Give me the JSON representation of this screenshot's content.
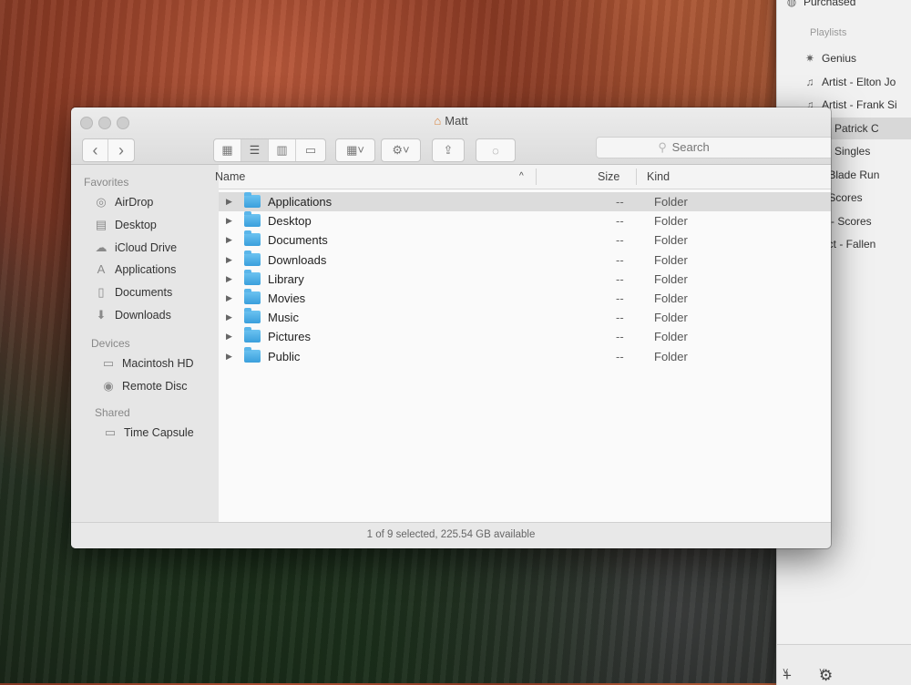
{
  "itunes": {
    "top_item": "Purchased",
    "playlists_header": "Playlists",
    "playlists": [
      {
        "label": "Genius",
        "icon": "genius-icon"
      },
      {
        "label": "Artist - Elton Jo",
        "icon": "playlist-icon"
      },
      {
        "label": "Artist - Frank Si",
        "icon": "playlist-icon"
      },
      {
        "label": "t - Patrick C",
        "icon": "playlist-icon"
      },
      {
        "label": "t - Singles",
        "icon": "playlist-icon"
      },
      {
        "label": "- Blade Run",
        "icon": "playlist-icon"
      },
      {
        "label": "- Scores",
        "icon": "playlist-icon"
      },
      {
        "label": "e - Scores",
        "icon": "playlist-icon"
      },
      {
        "label": "ect - Fallen",
        "icon": "playlist-icon"
      }
    ],
    "add_label": "+",
    "add_chevron": "˅",
    "gear_label": "⚙",
    "gear_chevron": "˅"
  },
  "finder": {
    "title": "Matt",
    "title_icon": "⌂",
    "nav": {
      "back": "‹",
      "forward": "›"
    },
    "view_buttons": [
      {
        "icon": "icon-view-icon",
        "glyph": "▦"
      },
      {
        "icon": "list-view-icon",
        "glyph": "☰"
      },
      {
        "icon": "column-view-icon",
        "glyph": "▥"
      },
      {
        "icon": "coverflow-view-icon",
        "glyph": "▭"
      }
    ],
    "arrange_glyph": "▦˅",
    "action_glyph": "⚙˅",
    "share_glyph": "⇪",
    "tag_glyph": "◌",
    "search_placeholder": "Search",
    "search_icon": "⚲",
    "sidebar": {
      "favorites_header": "Favorites",
      "favorites": [
        {
          "label": "AirDrop",
          "glyph": "◎",
          "icon": "airdrop-icon"
        },
        {
          "label": "Desktop",
          "glyph": "▤",
          "icon": "desktop-icon"
        },
        {
          "label": "iCloud Drive",
          "glyph": "☁",
          "icon": "icloud-icon"
        },
        {
          "label": "Applications",
          "glyph": "A",
          "icon": "applications-icon"
        },
        {
          "label": "Documents",
          "glyph": "▯",
          "icon": "documents-icon"
        },
        {
          "label": "Downloads",
          "glyph": "⬇",
          "icon": "downloads-icon"
        }
      ],
      "devices_header": "Devices",
      "devices": [
        {
          "label": "Macintosh HD",
          "glyph": "▭",
          "icon": "hard-drive-icon"
        },
        {
          "label": "Remote Disc",
          "glyph": "◉",
          "icon": "remote-disc-icon"
        }
      ],
      "shared_header": "Shared",
      "shared": [
        {
          "label": "Time Capsule",
          "glyph": "▭",
          "icon": "time-capsule-icon"
        }
      ]
    },
    "columns": {
      "name": "Name",
      "sort_indicator": "^",
      "size": "Size",
      "kind": "Kind"
    },
    "rows": [
      {
        "name": "Applications",
        "size": "--",
        "kind": "Folder",
        "selected": true
      },
      {
        "name": "Desktop",
        "size": "--",
        "kind": "Folder"
      },
      {
        "name": "Documents",
        "size": "--",
        "kind": "Folder"
      },
      {
        "name": "Downloads",
        "size": "--",
        "kind": "Folder"
      },
      {
        "name": "Library",
        "size": "--",
        "kind": "Folder"
      },
      {
        "name": "Movies",
        "size": "--",
        "kind": "Folder"
      },
      {
        "name": "Music",
        "size": "--",
        "kind": "Folder"
      },
      {
        "name": "Pictures",
        "size": "--",
        "kind": "Folder"
      },
      {
        "name": "Public",
        "size": "--",
        "kind": "Folder"
      }
    ],
    "disclosure_glyph": "▶",
    "status": "1 of 9 selected, 225.54 GB available"
  }
}
